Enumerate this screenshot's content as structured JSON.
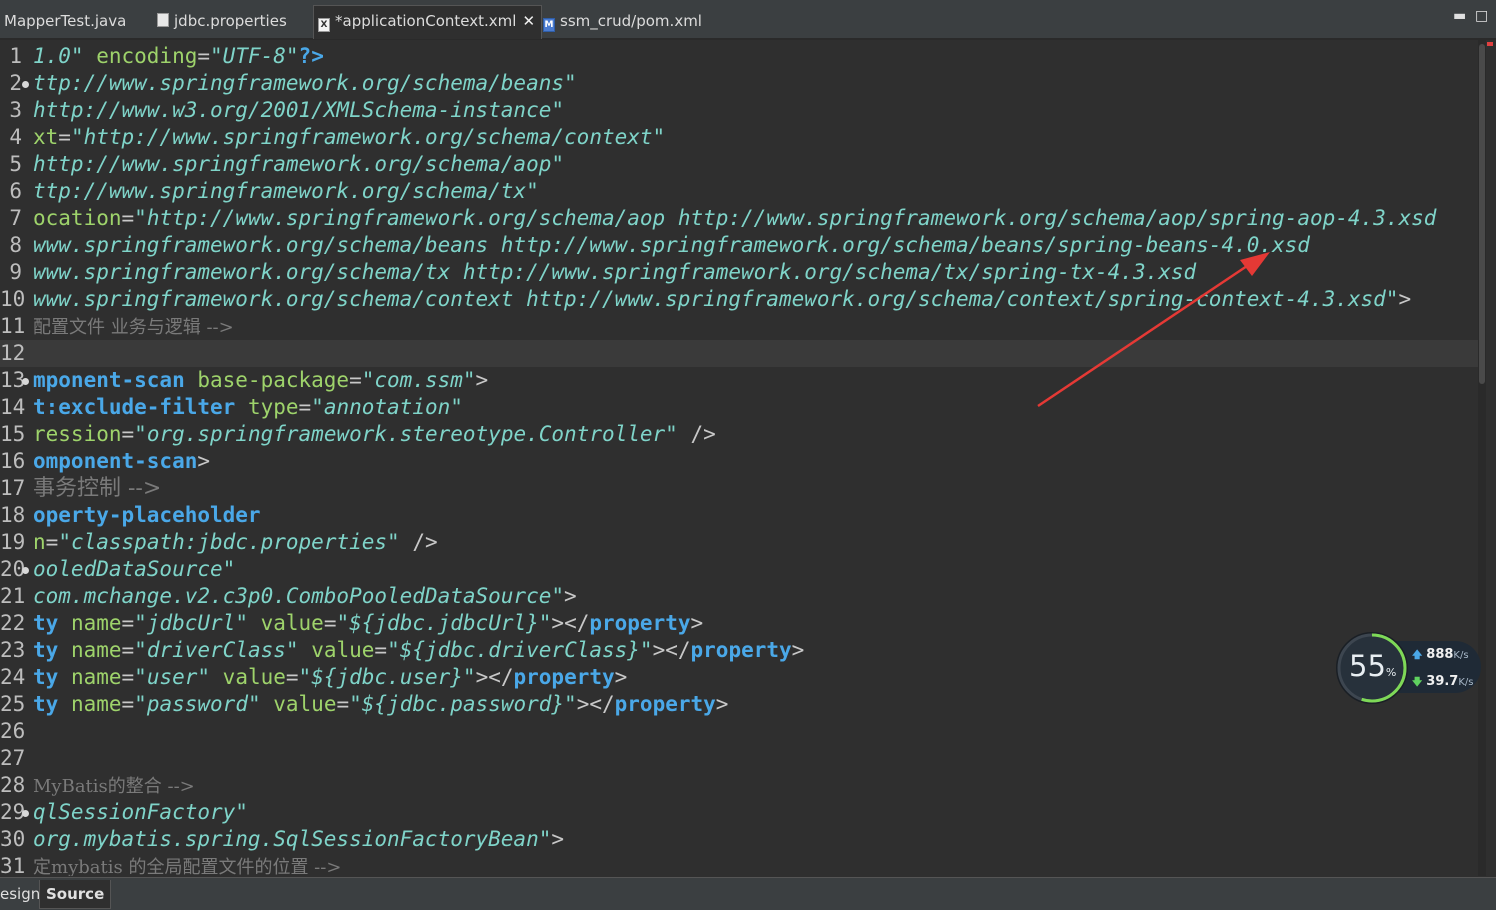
{
  "tabs": [
    {
      "label": "MapperTest.java",
      "icon": "java-file-icon"
    },
    {
      "label": "jdbc.properties",
      "icon": "properties-file-icon"
    },
    {
      "label": "*applicationContext.xml",
      "icon": "xml-file-icon",
      "active": true
    },
    {
      "label": "ssm_crud/pom.xml",
      "icon": "maven-file-icon"
    }
  ],
  "window_buttons": {
    "minimize": "▬",
    "maximize": "□"
  },
  "editor": {
    "lines": [
      {
        "n": "1",
        "segs": [
          [
            "val",
            "1.0\""
          ],
          [
            "attr",
            " encoding"
          ],
          [
            "pun",
            "="
          ],
          [
            "val",
            "\"UTF-8\""
          ],
          [
            "tag",
            "?>"
          ]
        ]
      },
      {
        "n": "2",
        "fold": true,
        "segs": [
          [
            "val",
            "ttp://www.springframework.org/schema/beans\""
          ]
        ]
      },
      {
        "n": "3",
        "segs": [
          [
            "val",
            "http://www.w3.org/2001/XMLSchema-instance\""
          ]
        ]
      },
      {
        "n": "4",
        "segs": [
          [
            "attr",
            "xt"
          ],
          [
            "pun",
            "="
          ],
          [
            "val",
            "\"http://www.springframework.org/schema/context\""
          ]
        ]
      },
      {
        "n": "5",
        "segs": [
          [
            "val",
            "http://www.springframework.org/schema/aop\""
          ]
        ]
      },
      {
        "n": "6",
        "segs": [
          [
            "val",
            "ttp://www.springframework.org/schema/tx\""
          ]
        ]
      },
      {
        "n": "7",
        "segs": [
          [
            "attr",
            "ocation"
          ],
          [
            "pun",
            "="
          ],
          [
            "val",
            "\"http://www.springframework.org/schema/aop http://www.springframework.org/schema/aop/spring-aop-4.3.xsd"
          ]
        ]
      },
      {
        "n": "8",
        "segs": [
          [
            "val",
            "www.springframework.org/schema/beans http://www.springframework.org/schema/beans/spring-beans-4.0.xsd"
          ]
        ]
      },
      {
        "n": "9",
        "segs": [
          [
            "val",
            "www.springframework.org/schema/tx http://www.springframework.org/schema/tx/spring-tx-4.3.xsd"
          ]
        ]
      },
      {
        "n": "10",
        "segs": [
          [
            "val",
            "www.springframework.org/schema/context http://www.springframework.org/schema/context/spring-context-4.3.xsd\""
          ],
          [
            "pun",
            ">"
          ]
        ]
      },
      {
        "n": "11",
        "segs": [
          [
            "com",
            "配置文件 业务与逻辑 -->"
          ]
        ]
      },
      {
        "n": "12",
        "current": true,
        "segs": []
      },
      {
        "n": "13",
        "fold": true,
        "segs": [
          [
            "tag",
            "mponent-scan"
          ],
          [
            "attr",
            " base-package"
          ],
          [
            "pun",
            "="
          ],
          [
            "val",
            "\"com.ssm\""
          ],
          [
            "pun",
            ">"
          ]
        ]
      },
      {
        "n": "14",
        "segs": [
          [
            "tag",
            "t:exclude-filter"
          ],
          [
            "attr",
            " type"
          ],
          [
            "pun",
            "="
          ],
          [
            "val",
            "\"annotation\""
          ]
        ]
      },
      {
        "n": "15",
        "segs": [
          [
            "attr",
            "ression"
          ],
          [
            "pun",
            "="
          ],
          [
            "val",
            "\"org.springframework.stereotype.Controller\""
          ],
          [
            "pun",
            " />"
          ]
        ]
      },
      {
        "n": "16",
        "segs": [
          [
            "tag",
            "omponent-scan"
          ],
          [
            "pun",
            ">"
          ]
        ]
      },
      {
        "n": "17",
        "segs": [
          [
            "combig",
            "事务控制 -->"
          ]
        ]
      },
      {
        "n": "18",
        "segs": [
          [
            "tag",
            "operty-placeholder"
          ]
        ]
      },
      {
        "n": "19",
        "segs": [
          [
            "attr",
            "n"
          ],
          [
            "pun",
            "="
          ],
          [
            "val",
            "\"classpath:jbdc.properties\""
          ],
          [
            "pun",
            " />"
          ]
        ]
      },
      {
        "n": "20",
        "fold": true,
        "segs": [
          [
            "val",
            "ooledDataSource\""
          ]
        ]
      },
      {
        "n": "21",
        "segs": [
          [
            "val",
            "com.mchange.v2.c3p0.ComboPooledDataSource\""
          ],
          [
            "pun",
            ">"
          ]
        ]
      },
      {
        "n": "22",
        "segs": [
          [
            "tag",
            "ty"
          ],
          [
            "attr",
            " name"
          ],
          [
            "pun",
            "="
          ],
          [
            "val",
            "\"jdbcUrl\""
          ],
          [
            "attr",
            " value"
          ],
          [
            "pun",
            "="
          ],
          [
            "val",
            "\"${jdbc.jdbcUrl}\""
          ],
          [
            "pun",
            "></"
          ],
          [
            "tag",
            "property"
          ],
          [
            "pun",
            ">"
          ]
        ]
      },
      {
        "n": "23",
        "segs": [
          [
            "tag",
            "ty"
          ],
          [
            "attr",
            " name"
          ],
          [
            "pun",
            "="
          ],
          [
            "val",
            "\"driverClass\""
          ],
          [
            "attr",
            " value"
          ],
          [
            "pun",
            "="
          ],
          [
            "val",
            "\"${jdbc.driverClass}\""
          ],
          [
            "pun",
            "></"
          ],
          [
            "tag",
            "property"
          ],
          [
            "pun",
            ">"
          ]
        ]
      },
      {
        "n": "24",
        "segs": [
          [
            "tag",
            "ty"
          ],
          [
            "attr",
            " name"
          ],
          [
            "pun",
            "="
          ],
          [
            "val",
            "\"user\""
          ],
          [
            "attr",
            " value"
          ],
          [
            "pun",
            "="
          ],
          [
            "val",
            "\"${jdbc.user}\""
          ],
          [
            "pun",
            "></"
          ],
          [
            "tag",
            "property"
          ],
          [
            "pun",
            ">"
          ]
        ]
      },
      {
        "n": "25",
        "segs": [
          [
            "tag",
            "ty"
          ],
          [
            "attr",
            " name"
          ],
          [
            "pun",
            "="
          ],
          [
            "val",
            "\"password\""
          ],
          [
            "attr",
            " value"
          ],
          [
            "pun",
            "="
          ],
          [
            "val",
            "\"${jdbc.password}\""
          ],
          [
            "pun",
            "></"
          ],
          [
            "tag",
            "property"
          ],
          [
            "pun",
            ">"
          ]
        ]
      },
      {
        "n": "26",
        "segs": []
      },
      {
        "n": "27",
        "segs": []
      },
      {
        "n": "28",
        "segs": [
          [
            "com",
            "MyBatis的整合 -->"
          ]
        ]
      },
      {
        "n": "29",
        "fold": true,
        "segs": [
          [
            "val",
            "qlSessionFactory\""
          ]
        ]
      },
      {
        "n": "30",
        "segs": [
          [
            "val",
            "org.mybatis.spring.SqlSessionFactoryBean\""
          ],
          [
            "pun",
            ">"
          ]
        ]
      },
      {
        "n": "31",
        "segs": [
          [
            "com",
            "定mybatis 的全局配置文件的位置 -->"
          ]
        ]
      }
    ]
  },
  "bottom_tabs": [
    {
      "label": "esign"
    },
    {
      "label": "Source",
      "active": true
    }
  ],
  "network_widget": {
    "cpu_percent": "55",
    "percent_sign": "%",
    "upload": "888",
    "upload_unit": "K/s",
    "download": "39.7",
    "download_unit": "K/s"
  },
  "colors": {
    "tag": "#4aa8e8",
    "attribute": "#9ed36b",
    "value": "#7fd4c9",
    "comment": "#7a7a7a",
    "arrow": "#e53935"
  }
}
